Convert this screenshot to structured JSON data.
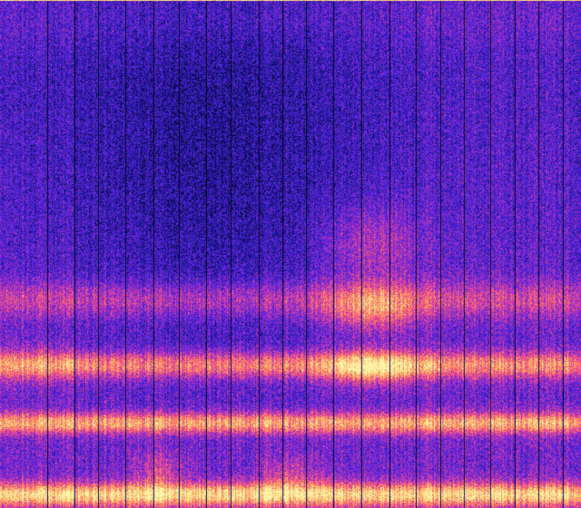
{
  "image": {
    "kind": "spectrogram-heatmap",
    "colormap": [
      "#000000",
      "#10106a",
      "#3a20d0",
      "#7a2ad8",
      "#d43aa8",
      "#ff6a6a",
      "#ffb060",
      "#fff6a8"
    ],
    "background_color": "#0a0226",
    "divider_color": "#000000"
  }
}
